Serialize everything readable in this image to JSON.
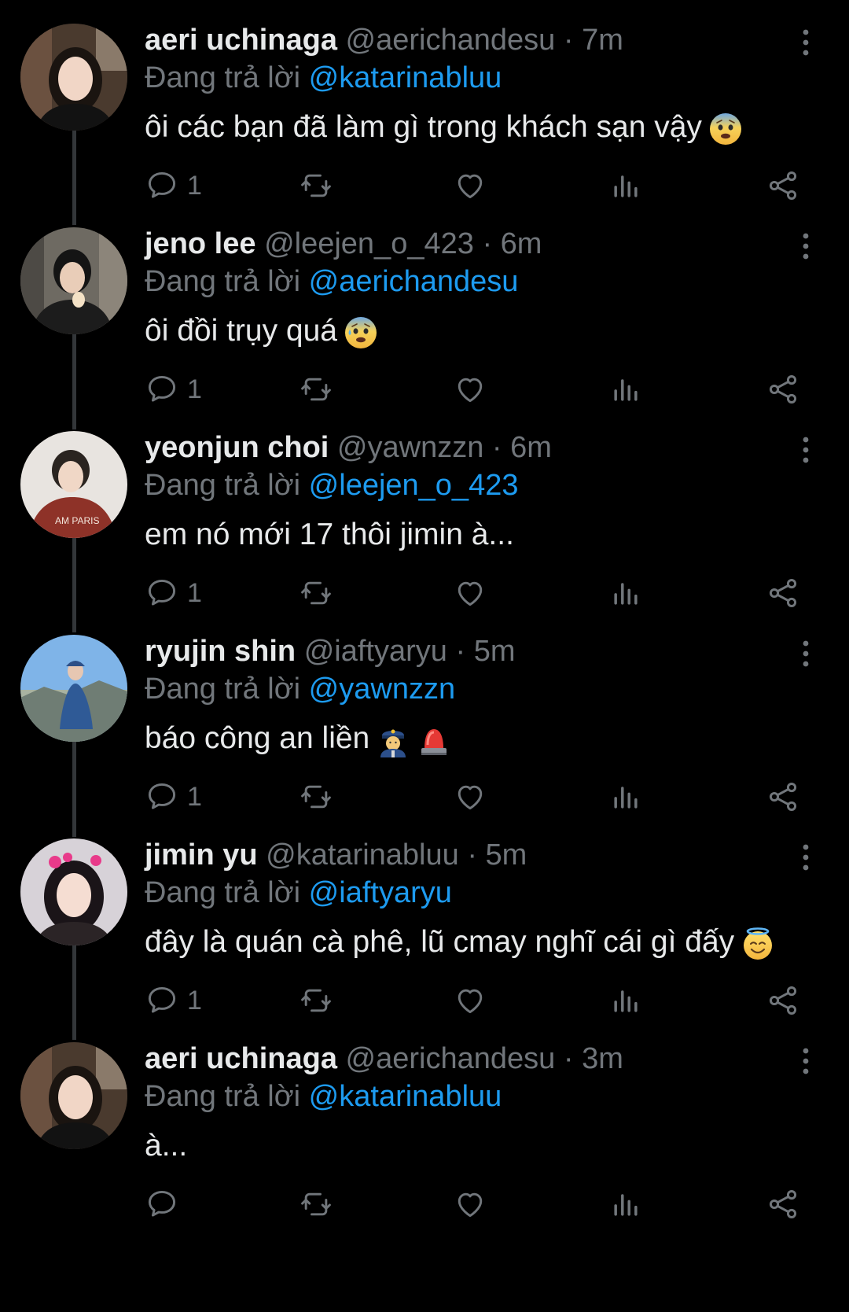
{
  "theme": {
    "background": "#000000",
    "text": "#e7e9ea",
    "muted": "#71767b",
    "accent": "#1d9bf0",
    "thread_line": "#333639"
  },
  "tweets": [
    {
      "name": "aeri uchinaga",
      "handle": "@aerichandesu",
      "sep": "·",
      "time": "7m",
      "replying_label": "Đang trả lời",
      "replying_to": "@katarinabluu",
      "text": "ôi các bạn đã làm gì trong khách sạn vậy",
      "emojis": [
        "anxious-face-emoji"
      ],
      "reply_count": "1",
      "avatar": "aeri-avatar"
    },
    {
      "name": "jeno lee",
      "handle": "@leejen_o_423",
      "sep": "·",
      "time": "6m",
      "replying_label": "Đang trả lời",
      "replying_to": "@aerichandesu",
      "text": "ôi đồi trụy quá",
      "emojis": [
        "anxious-sweat-face-emoji"
      ],
      "reply_count": "1",
      "avatar": "jeno-avatar"
    },
    {
      "name": "yeonjun choi",
      "handle": "@yawnzzn",
      "sep": "·",
      "time": "6m",
      "replying_label": "Đang trả lời",
      "replying_to": "@leejen_o_423",
      "text": "em nó mới 17 thôi jimin à...",
      "emojis": [],
      "reply_count": "1",
      "avatar": "yeonjun-avatar"
    },
    {
      "name": "ryujin shin",
      "handle": "@iaftyaryu",
      "sep": "·",
      "time": "5m",
      "replying_label": "Đang trả lời",
      "replying_to": "@yawnzzn",
      "text": "báo công an liền",
      "emojis": [
        "police-officer-emoji",
        "police-light-emoji"
      ],
      "reply_count": "1",
      "avatar": "ryujin-avatar"
    },
    {
      "name": "jimin yu",
      "handle": "@katarinabluu",
      "sep": "·",
      "time": "5m",
      "replying_label": "Đang trả lời",
      "replying_to": "@iaftyaryu",
      "text": "đây là quán cà phê, lũ cmay nghĩ cái gì đấy",
      "emojis": [
        "smiling-face-with-halo-emoji"
      ],
      "reply_count": "1",
      "avatar": "jimin-avatar"
    },
    {
      "name": "aeri uchinaga",
      "handle": "@aerichandesu",
      "sep": "·",
      "time": "3m",
      "replying_label": "Đang trả lời",
      "replying_to": "@katarinabluu",
      "text": "à...",
      "emojis": [],
      "reply_count": "",
      "avatar": "aeri-avatar"
    }
  ],
  "icons": {
    "reply": "reply-icon",
    "retweet": "retweet-icon",
    "like": "heart-icon",
    "views": "views-icon",
    "share": "share-icon",
    "more": "more-vertical-icon"
  }
}
